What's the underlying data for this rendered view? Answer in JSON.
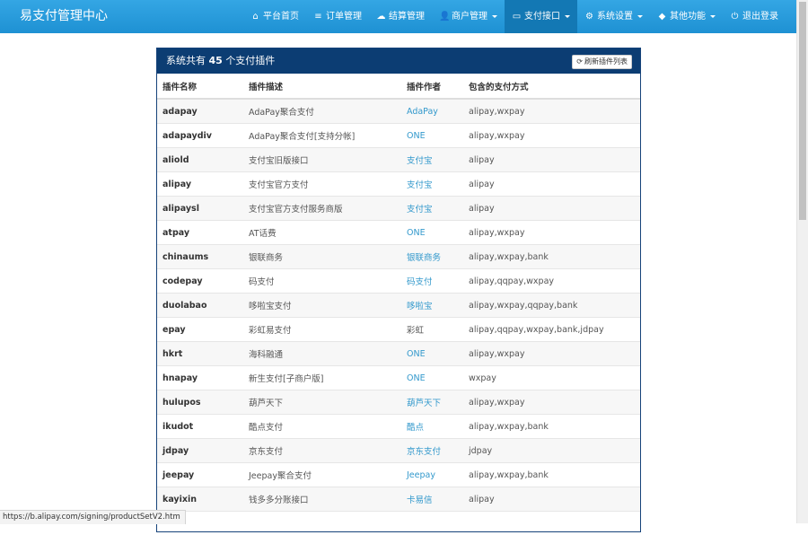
{
  "brand": "易支付管理中心",
  "nav": [
    {
      "icon": "home-icon",
      "glyph": "⌂",
      "label": "平台首页",
      "dropdown": false,
      "active": false
    },
    {
      "icon": "list-icon",
      "glyph": "≡",
      "label": "订单管理",
      "dropdown": false,
      "active": false
    },
    {
      "icon": "cloud-icon",
      "glyph": "☁",
      "label": "结算管理",
      "dropdown": false,
      "active": false
    },
    {
      "icon": "user-icon",
      "glyph": "👤",
      "label": "商户管理",
      "dropdown": true,
      "active": false
    },
    {
      "icon": "card-icon",
      "glyph": "▭",
      "label": "支付接口",
      "dropdown": true,
      "active": true
    },
    {
      "icon": "gear-icon",
      "glyph": "⚙",
      "label": "系统设置",
      "dropdown": true,
      "active": false
    },
    {
      "icon": "cube-icon",
      "glyph": "◆",
      "label": "其他功能",
      "dropdown": true,
      "active": false
    },
    {
      "icon": "power-icon",
      "glyph": "⏻",
      "label": "退出登录",
      "dropdown": false,
      "active": false
    }
  ],
  "panel": {
    "title_prefix": "系统共有",
    "count": "45",
    "title_suffix": "个支付插件",
    "refresh_label": "刷新插件列表"
  },
  "columns": [
    "插件名称",
    "插件描述",
    "插件作者",
    "包含的支付方式"
  ],
  "rows": [
    {
      "name": "adapay",
      "desc": "AdaPay聚合支付",
      "author": "AdaPay",
      "author_link": true,
      "methods": "alipay,wxpay"
    },
    {
      "name": "adapaydiv",
      "desc": "AdaPay聚合支付[支持分帐]",
      "author": "ONE",
      "author_link": true,
      "methods": "alipay,wxpay"
    },
    {
      "name": "aliold",
      "desc": "支付宝旧版接口",
      "author": "支付宝",
      "author_link": true,
      "methods": "alipay"
    },
    {
      "name": "alipay",
      "desc": "支付宝官方支付",
      "author": "支付宝",
      "author_link": true,
      "methods": "alipay"
    },
    {
      "name": "alipaysl",
      "desc": "支付宝官方支付服务商版",
      "author": "支付宝",
      "author_link": true,
      "methods": "alipay"
    },
    {
      "name": "atpay",
      "desc": "AT话费",
      "author": "ONE",
      "author_link": true,
      "methods": "alipay,wxpay"
    },
    {
      "name": "chinaums",
      "desc": "银联商务",
      "author": "银联商务",
      "author_link": true,
      "methods": "alipay,wxpay,bank"
    },
    {
      "name": "codepay",
      "desc": "码支付",
      "author": "码支付",
      "author_link": true,
      "methods": "alipay,qqpay,wxpay"
    },
    {
      "name": "duolabao",
      "desc": "哆啦宝支付",
      "author": "哆啦宝",
      "author_link": true,
      "methods": "alipay,wxpay,qqpay,bank"
    },
    {
      "name": "epay",
      "desc": "彩虹易支付",
      "author": "彩虹",
      "author_link": false,
      "methods": "alipay,qqpay,wxpay,bank,jdpay"
    },
    {
      "name": "hkrt",
      "desc": "海科融通",
      "author": "ONE",
      "author_link": true,
      "methods": "alipay,wxpay"
    },
    {
      "name": "hnapay",
      "desc": "新生支付[子商户版]",
      "author": "ONE",
      "author_link": true,
      "methods": "wxpay"
    },
    {
      "name": "hulupos",
      "desc": "葫芦天下",
      "author": "葫芦天下",
      "author_link": true,
      "methods": "alipay,wxpay"
    },
    {
      "name": "ikudot",
      "desc": "酷点支付",
      "author": "酷点",
      "author_link": true,
      "methods": "alipay,wxpay,bank"
    },
    {
      "name": "jdpay",
      "desc": "京东支付",
      "author": "京东支付",
      "author_link": true,
      "methods": "jdpay"
    },
    {
      "name": "jeepay",
      "desc": "Jeepay聚合支付",
      "author": "Jeepay",
      "author_link": true,
      "methods": "alipay,wxpay,bank"
    },
    {
      "name": "kayixin",
      "desc": "钱多多分账接口",
      "author": "卡易信",
      "author_link": true,
      "methods": "alipay"
    },
    {
      "name": "",
      "desc": "",
      "author": "",
      "author_link": true,
      "methods": ""
    }
  ],
  "statusbar": "https://b.alipay.com/signing/productSetV2.htm"
}
